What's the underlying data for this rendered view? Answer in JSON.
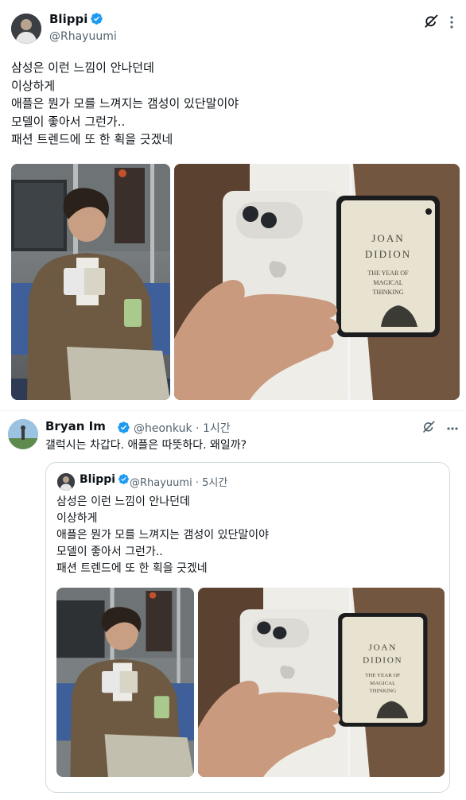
{
  "post": {
    "author_name": "Blippi",
    "author_handle": "@Rhayuumi",
    "text": "삼성은 이런 느낌이 안나던데\n이상하게\n애플은 뭔가 모를 느껴지는 갬성이 있단말이야\n모델이 좋아서 그런가..\n패션 트렌드에 또 한 획을 긋겠네",
    "media": [
      {
        "alt": "man on subway reading with phone"
      },
      {
        "alt": "hand holding foldable phone"
      }
    ],
    "book": {
      "line1": "JOAN",
      "line2": "DIDION",
      "line3": "THE YEAR OF",
      "line4": "MAGICAL",
      "line5": "THINKING"
    }
  },
  "reply": {
    "author_name": "Bryan Im",
    "author_handle": "@heonkuk",
    "time": "· 1시간",
    "text": "갤럭시는 차갑다. 애플은 따뜻하다. 왜일까?"
  },
  "quote": {
    "author_name": "Blippi",
    "author_handle": "@Rhayuumi",
    "time": "· 5시간",
    "text": "삼성은 이런 느낌이 안나던데\n이상하게\n애플은 뭔가 모를 느껴지는 갬성이 있단말이야\n모델이 좋아서 그런가..\n패션 트렌드에 또 한 획을 긋겠네"
  },
  "colors": {
    "verified": "#1d9bf0",
    "text": "#0f1419",
    "muted": "#536471",
    "border": "#cfd9de"
  },
  "icons": [
    "verified-badge-icon",
    "grok-icon",
    "more-icon"
  ]
}
